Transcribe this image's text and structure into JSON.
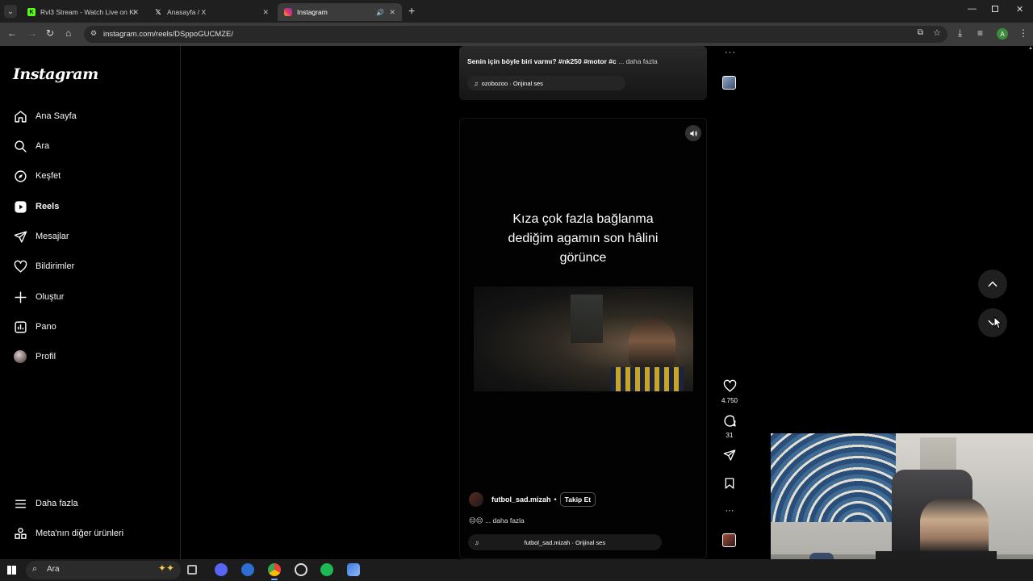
{
  "browser": {
    "tabs": [
      {
        "title": "Rvl3 Stream - Watch Live on Ki",
        "favicon": "kick-icon",
        "color": "#53fc18",
        "active": false
      },
      {
        "title": "Anasayfa / X",
        "favicon": "x-icon",
        "color": "#ffffff",
        "active": false
      },
      {
        "title": "Instagram",
        "favicon": "instagram-icon",
        "color": "#e1306c",
        "active": true
      }
    ],
    "url": "instagram.com/reels/DSppoGUCMZE/"
  },
  "sidebar": {
    "logo": "Instagram",
    "items": [
      {
        "label": "Ana Sayfa",
        "icon": "home-icon"
      },
      {
        "label": "Ara",
        "icon": "search-icon"
      },
      {
        "label": "Keşfet",
        "icon": "compass-icon"
      },
      {
        "label": "Reels",
        "icon": "reels-icon"
      },
      {
        "label": "Mesajlar",
        "icon": "send-icon"
      },
      {
        "label": "Bildirimler",
        "icon": "heart-icon"
      },
      {
        "label": "Oluştur",
        "icon": "plus-icon"
      },
      {
        "label": "Pano",
        "icon": "dashboard-icon"
      },
      {
        "label": "Profil",
        "icon": "avatar-icon"
      }
    ],
    "more": "Daha fazla",
    "meta": "Meta'nın diğer ürünleri"
  },
  "reel1": {
    "caption": "Senin için böyle biri varmı? #nk250 #motor #c",
    "more": "... daha fazla",
    "audio": "ozobozoo · Orijinal ses"
  },
  "reel2": {
    "overlay_text": [
      "Kıza çok fazla bağlanma",
      "dediğim agamın son hâlini",
      "görünce"
    ],
    "username": "futbol_sad.mizah",
    "dot": "•",
    "follow": "Takip Et",
    "emoji": "😔😔",
    "more": "... daha fazla",
    "audio": "futbol_sad.mizah · Orijinal ses",
    "likes": "4.750",
    "comments": "31"
  },
  "taskbar": {
    "search": "Ara"
  }
}
